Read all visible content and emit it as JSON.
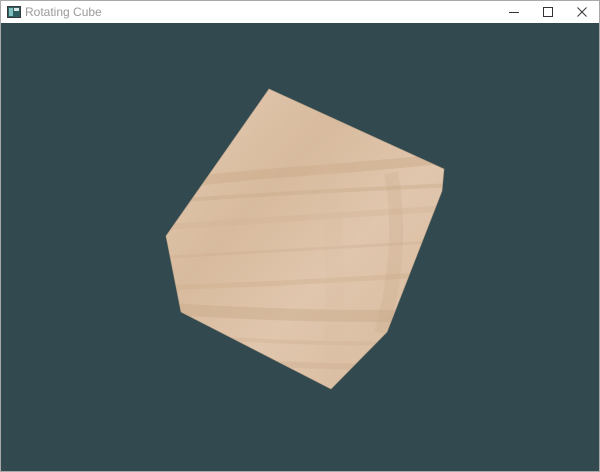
{
  "window": {
    "title": "Rotating Cube",
    "icon": "app-window-icon",
    "buttons": {
      "minimize": "minimize-icon",
      "maximize": "maximize-icon",
      "close": "close-icon"
    }
  },
  "scene": {
    "background_color": "#324a4f",
    "cube": {
      "texture": "wood",
      "face_color": "#dcc1a8",
      "grain_color": "#c4a584"
    }
  }
}
